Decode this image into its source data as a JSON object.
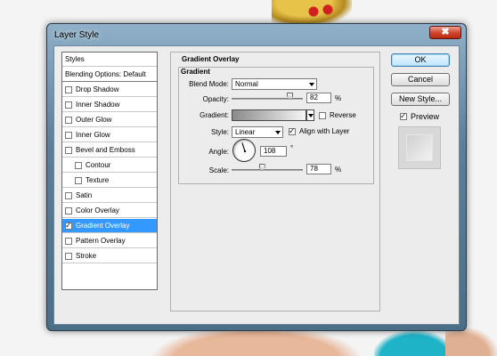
{
  "window": {
    "title": "Layer Style",
    "close_glyph": "✖"
  },
  "styles_list": {
    "items": [
      {
        "label": "Styles",
        "checkbox": false,
        "checked": false,
        "indent": false,
        "selected": false
      },
      {
        "label": "Blending Options: Default",
        "checkbox": false,
        "checked": false,
        "indent": false,
        "selected": false
      },
      {
        "label": "Drop Shadow",
        "checkbox": true,
        "checked": false,
        "indent": false,
        "selected": false
      },
      {
        "label": "Inner Shadow",
        "checkbox": true,
        "checked": false,
        "indent": false,
        "selected": false
      },
      {
        "label": "Outer Glow",
        "checkbox": true,
        "checked": false,
        "indent": false,
        "selected": false
      },
      {
        "label": "Inner Glow",
        "checkbox": true,
        "checked": false,
        "indent": false,
        "selected": false
      },
      {
        "label": "Bevel and Emboss",
        "checkbox": true,
        "checked": false,
        "indent": false,
        "selected": false
      },
      {
        "label": "Contour",
        "checkbox": true,
        "checked": false,
        "indent": true,
        "selected": false
      },
      {
        "label": "Texture",
        "checkbox": true,
        "checked": false,
        "indent": true,
        "selected": false
      },
      {
        "label": "Satin",
        "checkbox": true,
        "checked": false,
        "indent": false,
        "selected": false
      },
      {
        "label": "Color Overlay",
        "checkbox": true,
        "checked": false,
        "indent": false,
        "selected": false
      },
      {
        "label": "Gradient Overlay",
        "checkbox": true,
        "checked": true,
        "indent": false,
        "selected": true
      },
      {
        "label": "Pattern Overlay",
        "checkbox": true,
        "checked": false,
        "indent": false,
        "selected": false
      },
      {
        "label": "Stroke",
        "checkbox": true,
        "checked": false,
        "indent": false,
        "selected": false
      }
    ]
  },
  "panel": {
    "title": "Gradient Overlay",
    "section_title": "Gradient",
    "blend_mode_label": "Blend Mode:",
    "blend_mode_value": "Normal",
    "opacity_label": "Opacity:",
    "opacity_value": "82",
    "opacity_percent": 82,
    "opacity_unit": "%",
    "gradient_label": "Gradient:",
    "reverse_label": "Reverse",
    "reverse_checked": false,
    "style_label": "Style:",
    "style_value": "Linear",
    "align_label": "Align with Layer",
    "align_checked": true,
    "angle_label": "Angle:",
    "angle_value": "108",
    "angle_degrees": 108,
    "angle_unit": "°",
    "scale_label": "Scale:",
    "scale_value": "78",
    "scale_percent": 78,
    "scale_unit": "%"
  },
  "buttons": {
    "ok": "OK",
    "cancel": "Cancel",
    "new_style": "New Style...",
    "preview_label": "Preview",
    "preview_checked": true
  },
  "colors": {
    "selection": "#3399ff",
    "window_frame": "#5c7f98",
    "close_button": "#d04a30"
  }
}
